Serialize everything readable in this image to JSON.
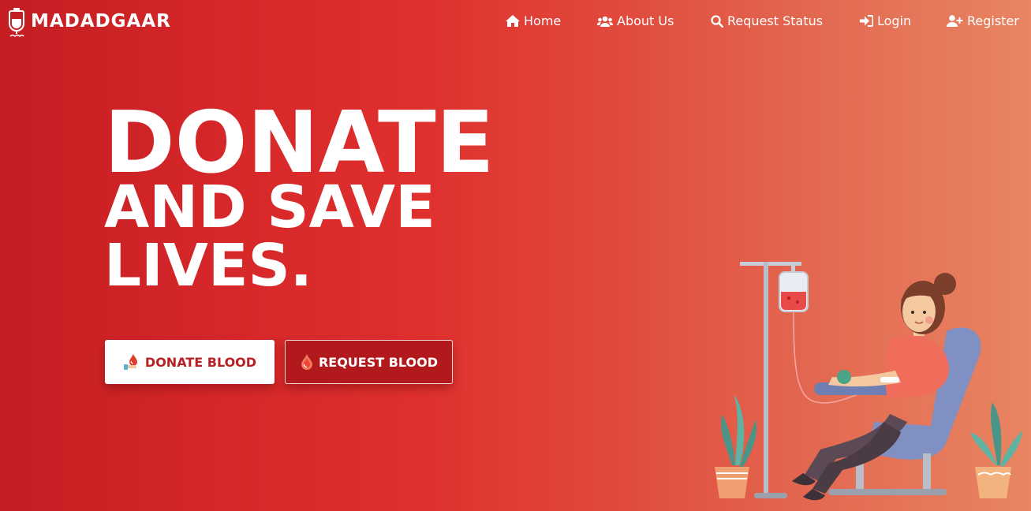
{
  "brand": {
    "name": "MADADGAAR",
    "logo_icon": "blood-bag-logo-icon"
  },
  "nav": {
    "items": [
      {
        "label": "Home",
        "icon": "home-icon"
      },
      {
        "label": "About Us",
        "icon": "users-icon"
      },
      {
        "label": "Request Status",
        "icon": "search-icon"
      },
      {
        "label": "Login",
        "icon": "sign-in-icon"
      },
      {
        "label": "Register",
        "icon": "user-plus-icon"
      }
    ]
  },
  "hero": {
    "line1": "DONATE",
    "line2": "AND SAVE",
    "line3": "LIVES."
  },
  "buttons": {
    "donate_label": "DONATE BLOOD",
    "request_label": "REQUEST BLOOD"
  },
  "colors": {
    "gradient_start": "#c41e22",
    "gradient_end": "#e88562",
    "primary_red": "#b82024",
    "white": "#ffffff"
  },
  "illustration": {
    "subject": "woman-donating-blood-illustration"
  }
}
